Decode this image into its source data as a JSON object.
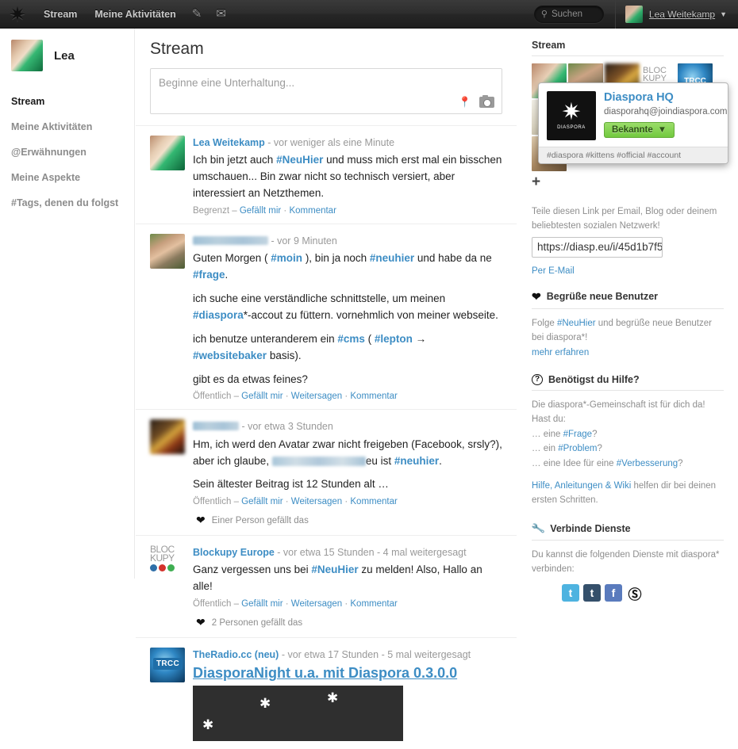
{
  "topbar": {
    "logo_icon": "diaspora-asterisk-logo",
    "nav": [
      {
        "label": "Stream",
        "name": "nav-stream"
      },
      {
        "label": "Meine Aktivitäten",
        "name": "nav-meine-aktivitaeten"
      }
    ],
    "icons": [
      {
        "glyph": "✎",
        "name": "contacts-icon"
      },
      {
        "glyph": "✉",
        "name": "messages-icon"
      }
    ],
    "search": {
      "placeholder": "Suchen",
      "value": "",
      "icon": "search-icon"
    },
    "user": {
      "name": "Lea Weitekamp",
      "caret": "▼"
    }
  },
  "sidebar": {
    "user_name": "Lea",
    "items": [
      {
        "label": "Stream",
        "active": true
      },
      {
        "label": "Meine Aktivitäten",
        "active": false
      },
      {
        "label": "@Erwähnungen",
        "active": false
      },
      {
        "label": "Meine Aspekte",
        "active": false
      },
      {
        "label": "#Tags, denen du folgst",
        "active": false
      }
    ]
  },
  "main": {
    "title": "Stream",
    "publisher": {
      "placeholder": "Beginne eine Unterhaltung...",
      "value": ""
    },
    "posts": [
      {
        "author": "Lea Weitekamp",
        "author_redacted": false,
        "meta": " - vor weniger als eine Minute",
        "avatar": "av-lea",
        "paragraphs": [
          [
            {
              "t": "text",
              "v": "Ich bin jetzt auch "
            },
            {
              "t": "tag",
              "v": "#NeuHier"
            },
            {
              "t": "text",
              "v": " und muss mich erst mal ein bisschen umschauen... Bin zwar nicht so technisch versiert, aber interessiert an Netzthemen."
            }
          ]
        ],
        "footer_scope": "Begrenzt – ",
        "footer_links": [
          "Gefällt mir",
          "Kommentar"
        ],
        "likes": ""
      },
      {
        "author": "",
        "author_redacted": true,
        "meta": " - vor 9 Minuten",
        "avatar": "av-man",
        "paragraphs": [
          [
            {
              "t": "text",
              "v": "Guten Morgen ( "
            },
            {
              "t": "tag",
              "v": "#moin"
            },
            {
              "t": "text",
              "v": " ), bin ja noch "
            },
            {
              "t": "tag",
              "v": "#neuhier"
            },
            {
              "t": "text",
              "v": " und habe da ne "
            },
            {
              "t": "tag",
              "v": "#frage"
            },
            {
              "t": "text",
              "v": "."
            }
          ],
          [
            {
              "t": "text",
              "v": "ich suche eine verständliche schnittstelle, um meinen "
            },
            {
              "t": "tag",
              "v": "#diaspora"
            },
            {
              "t": "text",
              "v": "*-accout zu füttern. vornehmlich von meiner webseite."
            }
          ],
          [
            {
              "t": "text",
              "v": "ich benutze unteranderem ein "
            },
            {
              "t": "tag",
              "v": "#cms"
            },
            {
              "t": "text",
              "v": " ( "
            },
            {
              "t": "tag",
              "v": "#lepton"
            },
            {
              "t": "text",
              "v": " → "
            },
            {
              "t": "tag",
              "v": "#websitebaker"
            },
            {
              "t": "text",
              "v": " basis)."
            }
          ],
          [
            {
              "t": "text",
              "v": "gibt es da etwas feines?"
            }
          ]
        ],
        "footer_scope": "Öffentlich – ",
        "footer_links": [
          "Gefällt mir",
          "Weitersagen",
          "Kommentar"
        ],
        "likes": ""
      },
      {
        "author": "",
        "author_redacted": true,
        "meta": " - vor etwa 3 Stunden",
        "avatar": "av-dark",
        "paragraphs": [
          [
            {
              "t": "text",
              "v": "Hm, ich werd den Avatar zwar nicht freigeben (Facebook, srsly?), aber ich glaube, "
            },
            {
              "t": "redact",
              "v": ""
            },
            {
              "t": "text",
              "v": "eu ist "
            },
            {
              "t": "tag",
              "v": "#neuhier"
            },
            {
              "t": "text",
              "v": "."
            }
          ],
          [
            {
              "t": "text",
              "v": "Sein ältester Beitrag ist 12 Stunden alt …"
            }
          ]
        ],
        "footer_scope": "Öffentlich – ",
        "footer_links": [
          "Gefällt mir",
          "Weitersagen",
          "Kommentar"
        ],
        "likes": "Einer Person gefällt das"
      },
      {
        "author": "Blockupy Europe",
        "author_redacted": false,
        "meta": " - vor etwa 15 Stunden - 4 mal weitergesagt",
        "avatar": "av-block",
        "paragraphs": [
          [
            {
              "t": "text",
              "v": "Ganz vergessen uns bei "
            },
            {
              "t": "tag",
              "v": "#NeuHier"
            },
            {
              "t": "text",
              "v": " zu melden! Also, Hallo an alle!"
            }
          ]
        ],
        "footer_scope": "Öffentlich – ",
        "footer_links": [
          "Gefällt mir",
          "Weitersagen",
          "Kommentar"
        ],
        "likes": "2 Personen gefällt das",
        "avatar_text_1": "BLOC",
        "avatar_text_2": "KUPY"
      },
      {
        "author": "TheRadio.cc (neu)",
        "author_redacted": false,
        "meta": " - vor etwa 17 Stunden - 5 mal weitergesagt",
        "avatar": "av-trcc",
        "avatar_badge": "TRCC",
        "big_title": "DiasporaNight u.a. mit Diaspora 0.3.0.0",
        "paragraphs": [],
        "footer_scope": "",
        "footer_links": [],
        "likes": ""
      }
    ]
  },
  "right": {
    "stream_section": {
      "title": "Stream",
      "more": "+"
    },
    "invite": {
      "text": "Teile diesen Link per Email, Blog oder deinem beliebtesten sozialen Netzwerk!",
      "link_value": "https://diasp.eu/i/45d1b7f5",
      "email_label": "Per E-Mail"
    },
    "welcome": {
      "title": "Begrüße neue Benutzer",
      "icon": "heart-icon",
      "text_before": "Folge ",
      "tag": "#NeuHier",
      "text_after": " und begrüße neue Benutzer bei diaspora*!",
      "more_link": "mehr erfahren"
    },
    "help": {
      "title": "Benötigst du Hilfe?",
      "icon": "question-mark-icon",
      "line1": "Die diaspora*-Gemeinschaft ist für dich da!",
      "line2": "Hast du:",
      "bullets": [
        {
          "prefix": "… eine ",
          "tag": "#Frage",
          "suffix": "?"
        },
        {
          "prefix": "… ein ",
          "tag": "#Problem",
          "suffix": "?"
        },
        {
          "prefix": "… eine Idee für eine ",
          "tag": "#Verbesserung",
          "suffix": "?"
        }
      ],
      "footer_link": "Hilfe, Anleitungen & Wiki",
      "footer_text": " helfen dir bei deinen ersten Schritten."
    },
    "services": {
      "title": "Verbinde Dienste",
      "icon": "wrench-icon",
      "text": "Du kannst die folgenden Dienste mit diaspora* verbinden:",
      "items": [
        {
          "name": "twitter",
          "glyph": "t",
          "color": "#4eb3e0"
        },
        {
          "name": "tumblr",
          "glyph": "t",
          "color": "#35506b"
        },
        {
          "name": "facebook",
          "glyph": "f",
          "color": "#5a7bbd"
        },
        {
          "name": "wordpress",
          "glyph": "W",
          "color": "#ffffff"
        }
      ]
    }
  },
  "hovercard": {
    "name": "Diaspora HQ",
    "email": "diasporahq@joindiaspora.com",
    "button_label": "Bekannte",
    "button_caret": "▼",
    "logo_word": "DIASPORA",
    "tags": "#diaspora #kittens #official #account"
  }
}
